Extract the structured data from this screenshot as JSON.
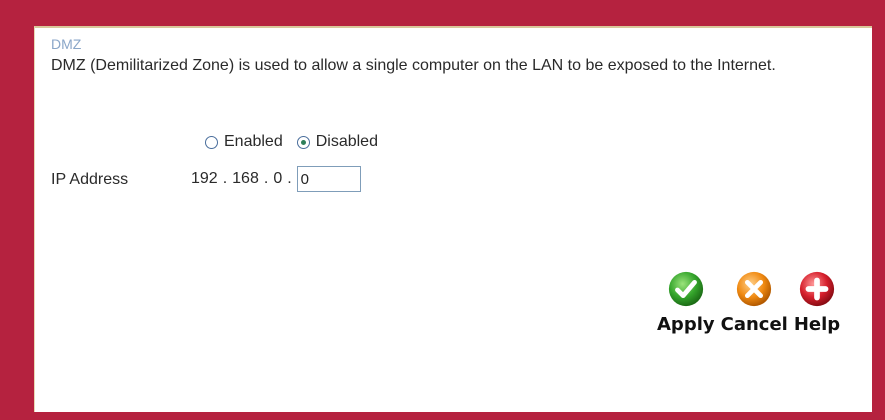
{
  "section": {
    "title": "DMZ",
    "description": "DMZ (Demilitarized Zone) is used to allow a single computer on the LAN to be exposed to the Internet."
  },
  "mode": {
    "options": [
      {
        "label": "Enabled",
        "selected": false
      },
      {
        "label": "Disabled",
        "selected": true
      }
    ]
  },
  "ip": {
    "label": "IP Address",
    "octet1": "192",
    "octet2": "168",
    "octet3": "0",
    "octet4_value": "0",
    "separator": "."
  },
  "actions": {
    "apply": {
      "label": "Apply",
      "icon": "check-icon",
      "color": "#2f9a2a"
    },
    "cancel": {
      "label": "Cancel",
      "icon": "x-icon",
      "color": "#f08a12"
    },
    "help": {
      "label": "Help",
      "icon": "plus-icon",
      "color": "#d61f2c"
    }
  },
  "colors": {
    "frame": "#b5223f",
    "panel": "#ffffff",
    "title": "#8aa6c8"
  }
}
